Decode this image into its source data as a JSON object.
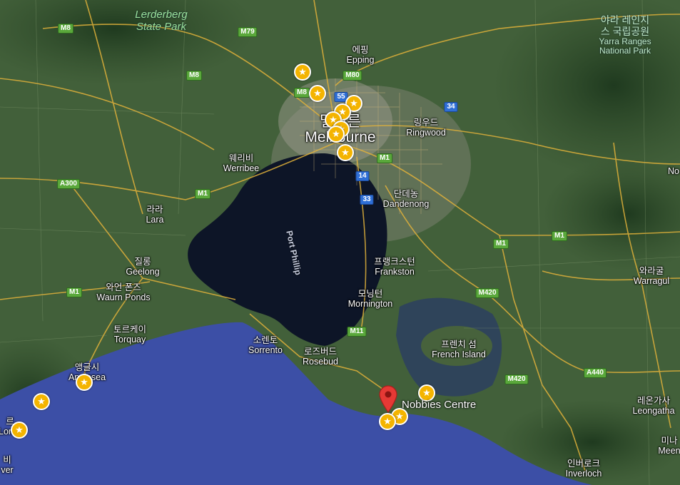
{
  "colors": {
    "land": "#3d5a32",
    "bay": "#0d1527",
    "ocean": "#3c4fa6",
    "road": "#e0b13a",
    "marker": "#f4b400",
    "pin": "#e53935"
  },
  "places": [
    {
      "ko": "",
      "en": "Lerderberg State Park",
      "lines": [
        "Lerderberg",
        "State Park"
      ],
      "style": "park"
    },
    {
      "ko": "에핑",
      "en": "Epping"
    },
    {
      "ko": "링우드",
      "en": "Ringwood"
    },
    {
      "ko": "멜버른",
      "en": "Melbourne",
      "style": "big"
    },
    {
      "ko": "웨리비",
      "en": "Werribee"
    },
    {
      "ko": "라라",
      "en": "Lara"
    },
    {
      "ko": "단데농",
      "en": "Dandenong"
    },
    {
      "ko": "질롱",
      "en": "Geelong"
    },
    {
      "ko": "와언 폰즈",
      "en": "Waurn Ponds"
    },
    {
      "ko": "프랭크스턴",
      "en": "Frankston"
    },
    {
      "ko": "모닝턴",
      "en": "Mornington"
    },
    {
      "ko": "토르케이",
      "en": "Torquay"
    },
    {
      "ko": "소렌토",
      "en": "Sorrento"
    },
    {
      "ko": "로즈버드",
      "en": "Rosebud"
    },
    {
      "ko": "프렌치 섬",
      "en": "French Island"
    },
    {
      "ko": "앵글시",
      "en": "Anglesea"
    },
    {
      "ko": "와라굴",
      "en": "Warragul"
    },
    {
      "ko": "레온가사",
      "en": "Leongatha"
    },
    {
      "ko": "인버로크",
      "en": "Inverloch"
    },
    {
      "ko": "미나",
      "en": "Meen"
    },
    {
      "ko": "",
      "en": "No"
    },
    {
      "ko": "르",
      "en": "Lorne"
    },
    {
      "ko": "비",
      "en": "ver"
    }
  ],
  "park_east": {
    "ko_lines": [
      "야라 레인지",
      "스 국립공원"
    ],
    "en_lines": [
      "Yarra Ranges",
      "National Park"
    ]
  },
  "bay_label": "Port Phillip",
  "road_shields": [
    {
      "text": "M8",
      "color": "green"
    },
    {
      "text": "M79",
      "color": "green"
    },
    {
      "text": "M8",
      "color": "green"
    },
    {
      "text": "M80",
      "color": "green"
    },
    {
      "text": "M8",
      "color": "green"
    },
    {
      "text": "55",
      "color": "blue"
    },
    {
      "text": "34",
      "color": "blue"
    },
    {
      "text": "M1",
      "color": "green"
    },
    {
      "text": "14",
      "color": "blue"
    },
    {
      "text": "33",
      "color": "blue"
    },
    {
      "text": "A300",
      "color": "green"
    },
    {
      "text": "M1",
      "color": "green"
    },
    {
      "text": "M1",
      "color": "green"
    },
    {
      "text": "M1",
      "color": "green"
    },
    {
      "text": "M1",
      "color": "green"
    },
    {
      "text": "M420",
      "color": "green"
    },
    {
      "text": "M11",
      "color": "green"
    },
    {
      "text": "A440",
      "color": "green"
    },
    {
      "text": "M420",
      "color": "green"
    }
  ],
  "saved_place_icon": "star-icon",
  "selected": {
    "label": "Nobbies Centre",
    "icon": "map-pin-icon"
  }
}
